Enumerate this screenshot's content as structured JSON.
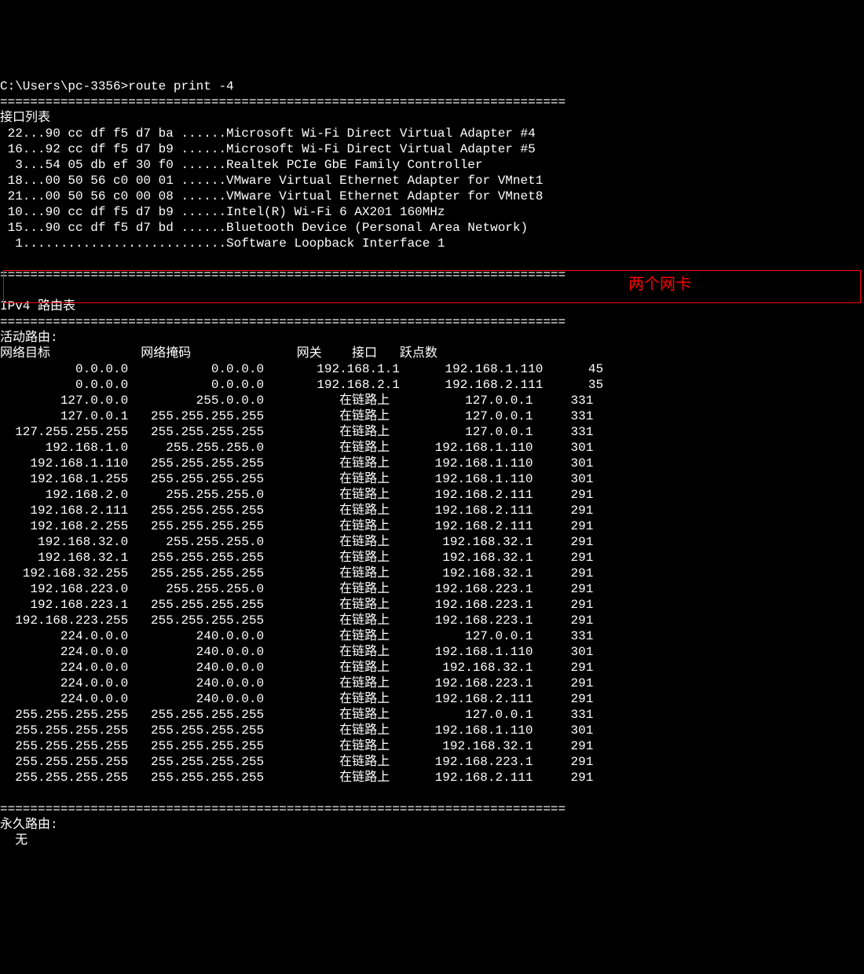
{
  "prompt": "C:\\Users\\pc-3356>",
  "command": "route print -4",
  "separator": "===========================================================================",
  "interface_list_header": "接口列表",
  "interfaces": [
    " 22...90 cc df f5 d7 ba ......Microsoft Wi-Fi Direct Virtual Adapter #4",
    " 16...92 cc df f5 d7 b9 ......Microsoft Wi-Fi Direct Virtual Adapter #5",
    "  3...54 05 db ef 30 f0 ......Realtek PCIe GbE Family Controller",
    " 18...00 50 56 c0 00 01 ......VMware Virtual Ethernet Adapter for VMnet1",
    " 21...00 50 56 c0 00 08 ......VMware Virtual Ethernet Adapter for VMnet8",
    " 10...90 cc df f5 d7 b9 ......Intel(R) Wi-Fi 6 AX201 160MHz",
    " 15...90 cc df f5 d7 bd ......Bluetooth Device (Personal Area Network)",
    "  1...........................Software Loopback Interface 1"
  ],
  "route_table_header": "IPv4 路由表",
  "active_routes_label": "活动路由:",
  "columns": {
    "dest": "网络目标",
    "mask": "网络掩码",
    "gateway": "网关",
    "iface": "接口",
    "metric": "跃点数"
  },
  "routes": [
    {
      "dest": "0.0.0.0",
      "mask": "0.0.0.0",
      "gw": "192.168.1.1",
      "if": "192.168.1.110",
      "metric": "45"
    },
    {
      "dest": "0.0.0.0",
      "mask": "0.0.0.0",
      "gw": "192.168.2.1",
      "if": "192.168.2.111",
      "metric": "35"
    },
    {
      "dest": "127.0.0.0",
      "mask": "255.0.0.0",
      "gw": "在链路上",
      "if": "127.0.0.1",
      "metric": "331"
    },
    {
      "dest": "127.0.0.1",
      "mask": "255.255.255.255",
      "gw": "在链路上",
      "if": "127.0.0.1",
      "metric": "331"
    },
    {
      "dest": "127.255.255.255",
      "mask": "255.255.255.255",
      "gw": "在链路上",
      "if": "127.0.0.1",
      "metric": "331"
    },
    {
      "dest": "192.168.1.0",
      "mask": "255.255.255.0",
      "gw": "在链路上",
      "if": "192.168.1.110",
      "metric": "301"
    },
    {
      "dest": "192.168.1.110",
      "mask": "255.255.255.255",
      "gw": "在链路上",
      "if": "192.168.1.110",
      "metric": "301"
    },
    {
      "dest": "192.168.1.255",
      "mask": "255.255.255.255",
      "gw": "在链路上",
      "if": "192.168.1.110",
      "metric": "301"
    },
    {
      "dest": "192.168.2.0",
      "mask": "255.255.255.0",
      "gw": "在链路上",
      "if": "192.168.2.111",
      "metric": "291"
    },
    {
      "dest": "192.168.2.111",
      "mask": "255.255.255.255",
      "gw": "在链路上",
      "if": "192.168.2.111",
      "metric": "291"
    },
    {
      "dest": "192.168.2.255",
      "mask": "255.255.255.255",
      "gw": "在链路上",
      "if": "192.168.2.111",
      "metric": "291"
    },
    {
      "dest": "192.168.32.0",
      "mask": "255.255.255.0",
      "gw": "在链路上",
      "if": "192.168.32.1",
      "metric": "291"
    },
    {
      "dest": "192.168.32.1",
      "mask": "255.255.255.255",
      "gw": "在链路上",
      "if": "192.168.32.1",
      "metric": "291"
    },
    {
      "dest": "192.168.32.255",
      "mask": "255.255.255.255",
      "gw": "在链路上",
      "if": "192.168.32.1",
      "metric": "291"
    },
    {
      "dest": "192.168.223.0",
      "mask": "255.255.255.0",
      "gw": "在链路上",
      "if": "192.168.223.1",
      "metric": "291"
    },
    {
      "dest": "192.168.223.1",
      "mask": "255.255.255.255",
      "gw": "在链路上",
      "if": "192.168.223.1",
      "metric": "291"
    },
    {
      "dest": "192.168.223.255",
      "mask": "255.255.255.255",
      "gw": "在链路上",
      "if": "192.168.223.1",
      "metric": "291"
    },
    {
      "dest": "224.0.0.0",
      "mask": "240.0.0.0",
      "gw": "在链路上",
      "if": "127.0.0.1",
      "metric": "331"
    },
    {
      "dest": "224.0.0.0",
      "mask": "240.0.0.0",
      "gw": "在链路上",
      "if": "192.168.1.110",
      "metric": "301"
    },
    {
      "dest": "224.0.0.0",
      "mask": "240.0.0.0",
      "gw": "在链路上",
      "if": "192.168.32.1",
      "metric": "291"
    },
    {
      "dest": "224.0.0.0",
      "mask": "240.0.0.0",
      "gw": "在链路上",
      "if": "192.168.223.1",
      "metric": "291"
    },
    {
      "dest": "224.0.0.0",
      "mask": "240.0.0.0",
      "gw": "在链路上",
      "if": "192.168.2.111",
      "metric": "291"
    },
    {
      "dest": "255.255.255.255",
      "mask": "255.255.255.255",
      "gw": "在链路上",
      "if": "127.0.0.1",
      "metric": "331"
    },
    {
      "dest": "255.255.255.255",
      "mask": "255.255.255.255",
      "gw": "在链路上",
      "if": "192.168.1.110",
      "metric": "301"
    },
    {
      "dest": "255.255.255.255",
      "mask": "255.255.255.255",
      "gw": "在链路上",
      "if": "192.168.32.1",
      "metric": "291"
    },
    {
      "dest": "255.255.255.255",
      "mask": "255.255.255.255",
      "gw": "在链路上",
      "if": "192.168.223.1",
      "metric": "291"
    },
    {
      "dest": "255.255.255.255",
      "mask": "255.255.255.255",
      "gw": "在链路上",
      "if": "192.168.2.111",
      "metric": "291"
    }
  ],
  "persistent_routes_label": "永久路由:",
  "persistent_routes_none": "  无",
  "annotation_label": "两个网卡"
}
